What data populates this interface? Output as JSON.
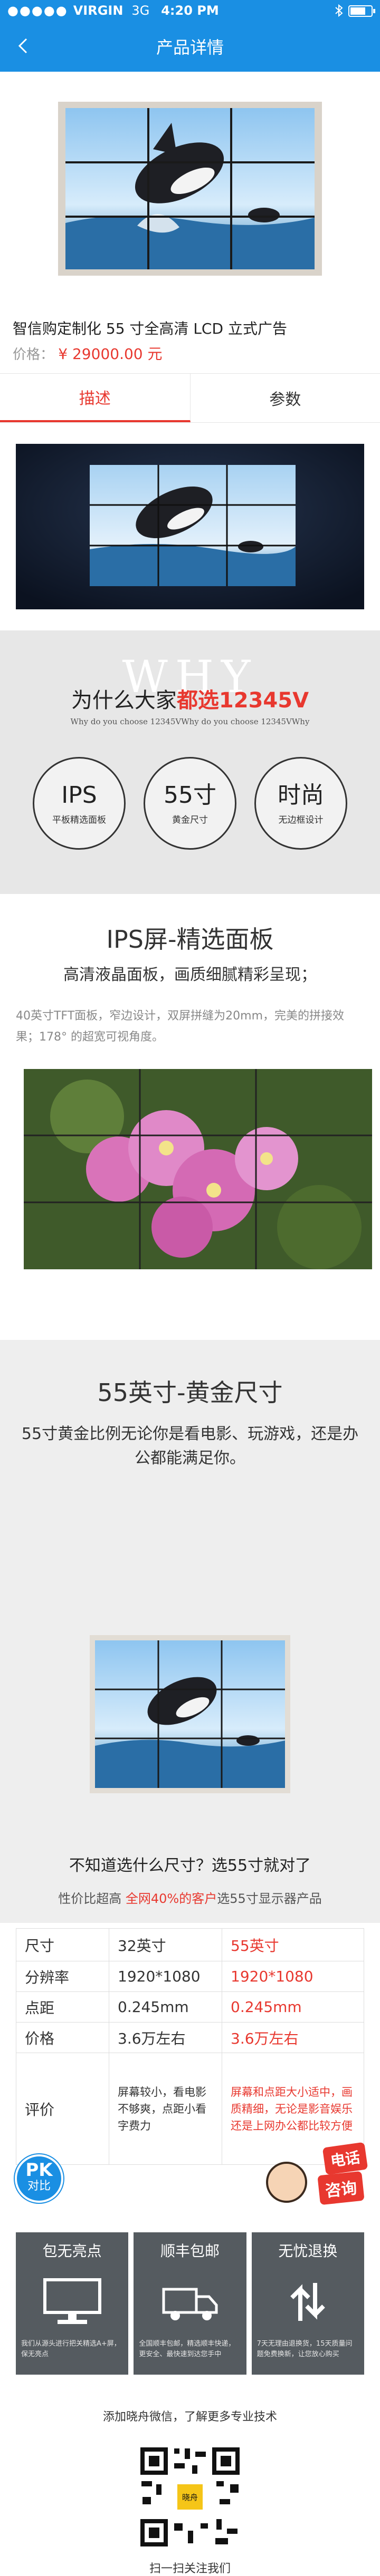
{
  "status_bar": {
    "signal": "●●●●●",
    "carrier": "VIRGIN",
    "network": "3G",
    "time": "4:20 PM"
  },
  "nav": {
    "title": "产品详情",
    "back_icon": "chevron-left-icon"
  },
  "product": {
    "title": "智信购定制化 55 寸全高清 LCD 立式广告",
    "price_label": "价格：",
    "price": "¥ 29000.00 元"
  },
  "tabs": [
    {
      "label": "描述",
      "active": true
    },
    {
      "label": "参数",
      "active": false
    }
  ],
  "why": {
    "big": "WHY",
    "title_prefix": "为什么大家",
    "title_highlight": "都选12345V",
    "subtitle": "Why do you choose 12345VWhy do you choose 12345VWhy",
    "features": [
      {
        "big": "IPS",
        "small": "平板精选面板"
      },
      {
        "big": "55寸",
        "small": "黄金尺寸"
      },
      {
        "big": "时尚",
        "small": "无边框设计"
      }
    ]
  },
  "ips_section": {
    "title": "IPS屏-精选面板",
    "subtitle": "高清液晶面板，画质细腻精彩呈现；",
    "desc": "40英寸TFT面板，窄边设计，双屏拼缝为20mm，完美的拼接效果；178° 的超宽可视角度。"
  },
  "gold_section": {
    "title": "55英寸-黄金尺寸",
    "subtitle": "55寸黄金比例无论你是看电影、玩游戏，还是办公都能满足你。"
  },
  "question": {
    "text": "不知道选什么尺寸？选55寸就对了",
    "stat_prefix": "性价比超高 ",
    "stat_highlight": "全网40%的客户",
    "stat_suffix": "选55寸显示器产品"
  },
  "comparison": {
    "rows": [
      {
        "label": "尺寸",
        "a": "32英寸",
        "b": "55英寸"
      },
      {
        "label": "分辨率",
        "a": "1920*1080",
        "b": "1920*1080"
      },
      {
        "label": "点距",
        "a": "0.245mm",
        "b": "0.245mm"
      },
      {
        "label": "价格",
        "a": "3.6万左右",
        "b": "3.6万左右"
      },
      {
        "label": "评价",
        "a": "屏幕较小，看电影不够爽，点距小看字费力",
        "b": "屏幕和点距大小适中，画质精细，无论是影音娱乐还是上网办公都比较方便"
      }
    ]
  },
  "pk_badge": {
    "line1": "PK",
    "line2": "对比"
  },
  "call_badge": {
    "line1": "电话",
    "line2": "咨询"
  },
  "services": [
    {
      "title": "包无亮点",
      "icon": "monitor-icon",
      "desc": "我们从源头进行把关精选A+屏，保无亮点"
    },
    {
      "title": "顺丰包邮",
      "icon": "truck-icon",
      "desc": "全国顺丰包邮，精选顺丰快递，更安全、最快速到达您手中"
    },
    {
      "title": "无忧退换",
      "icon": "exchange-icon",
      "desc": "7天无理由退换货，15天质量问题免费换新，让您放心购买"
    }
  ],
  "footer": {
    "follow": "添加晓舟微信，了解更多专业技术",
    "qr_icon": "qr-code-icon",
    "qr_logo": "晓舟",
    "scan": "扫一扫关注我们"
  },
  "colors": {
    "primary": "#1a8fe3",
    "accent": "#e8382f",
    "service_bg": "#555b60"
  }
}
